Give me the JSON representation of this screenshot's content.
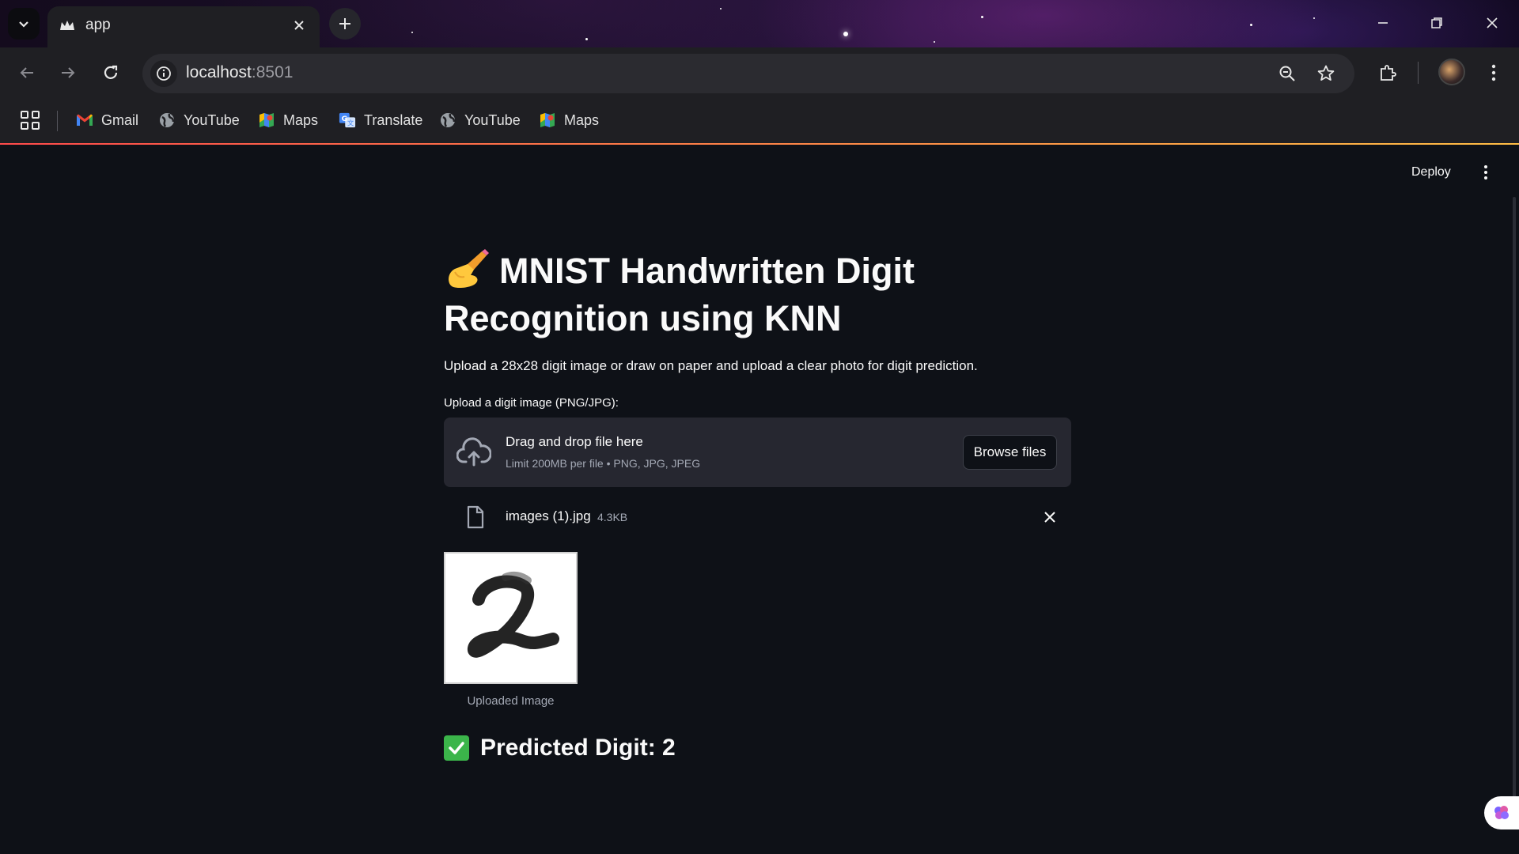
{
  "browser": {
    "tab_title": "app",
    "url_host": "localhost",
    "url_port": ":8501",
    "bookmarks": [
      {
        "label": "Gmail",
        "icon": "gmail-icon"
      },
      {
        "label": "YouTube",
        "icon": "globe-icon"
      },
      {
        "label": "Maps",
        "icon": "maps-icon"
      },
      {
        "label": "Translate",
        "icon": "translate-icon"
      },
      {
        "label": "YouTube",
        "icon": "globe-icon"
      },
      {
        "label": "Maps",
        "icon": "maps-icon"
      }
    ]
  },
  "app": {
    "deploy_label": "Deploy",
    "title": "MNIST Handwritten Digit Recognition using KNN",
    "title_emoji": "writing-hand-icon",
    "description": "Upload a 28x28 digit image or draw on paper and upload a clear photo for digit prediction.",
    "uploader": {
      "label": "Upload a digit image (PNG/JPG):",
      "drop_title": "Drag and drop file here",
      "drop_subtitle": "Limit 200MB per file • PNG, JPG, JPEG",
      "browse_label": "Browse files"
    },
    "file": {
      "name": "images (1).jpg",
      "size": "4.3KB"
    },
    "image_caption": "Uploaded Image",
    "result_text": "Predicted Digit: 2"
  },
  "colors": {
    "background": "#0e1117",
    "dropzone": "#262730",
    "success": "#3bb54a",
    "accent_gradient": [
      "#ff4b4b",
      "#ffbd45"
    ]
  }
}
